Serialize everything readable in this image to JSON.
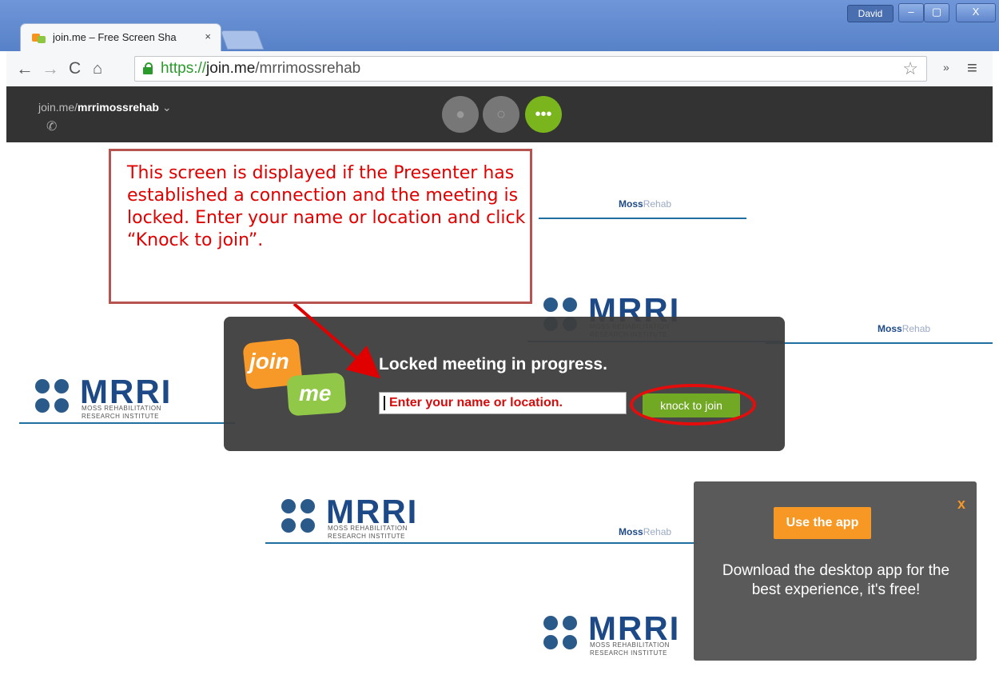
{
  "browser": {
    "tab_title": "join.me – Free Screen Sha",
    "tab_close": "×",
    "user_badge": "David",
    "win_min": "–",
    "win_max": "▢",
    "win_close": "X",
    "url_scheme": "https://",
    "url_host": "join.me",
    "url_path": "/mrrimossrehab",
    "ext_more": "»"
  },
  "app": {
    "meeting_prefix": "join.me/",
    "meeting_name": "mrrimossrehab",
    "meeting_chevron": "⌄",
    "more_label": "•••"
  },
  "logos": {
    "mrri": "MRRI",
    "mrri_sub1": "MOSS REHABILITATION",
    "mrri_sub2": "RESEARCH INSTITUTE",
    "moss_bold": "Moss",
    "moss_rest": "Rehab"
  },
  "dialog": {
    "title": "Locked meeting in progress.",
    "logo_join": "join",
    "logo_me": "me",
    "name_placeholder": "Enter your name or location.",
    "knock_label": "knock to join"
  },
  "callout": {
    "text": "This screen is displayed if the Presenter has established a connection and the meeting is locked. Enter your name or location and click “Knock to join”."
  },
  "promo": {
    "close": "x",
    "button": "Use the app",
    "text": "Download the desktop app for the best experience, it's free!"
  },
  "colors": {
    "accent_green": "#7ab51d",
    "joinme_orange": "#f7941d",
    "annotation_red": "#e00000"
  }
}
